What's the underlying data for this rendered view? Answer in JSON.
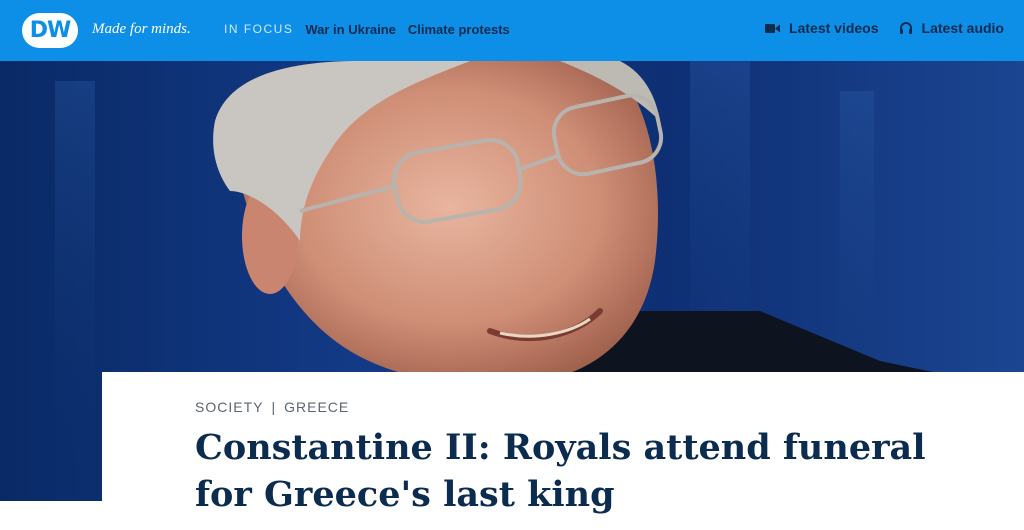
{
  "header": {
    "logo_text": "DW",
    "tagline": "Made for minds.",
    "in_focus_label": "IN FOCUS",
    "focus_links": [
      "War in Ukraine",
      "Climate protests"
    ],
    "latest_videos_label": "Latest videos",
    "latest_audio_label": "Latest audio"
  },
  "article": {
    "kicker": {
      "category": "SOCIETY",
      "separator": "|",
      "region": "GREECE"
    },
    "headline": "Constantine II: Royals attend funeral for Greece's last king"
  },
  "colors": {
    "brand_blue": "#0d8fe8",
    "headline_navy": "#0b2b4f"
  }
}
